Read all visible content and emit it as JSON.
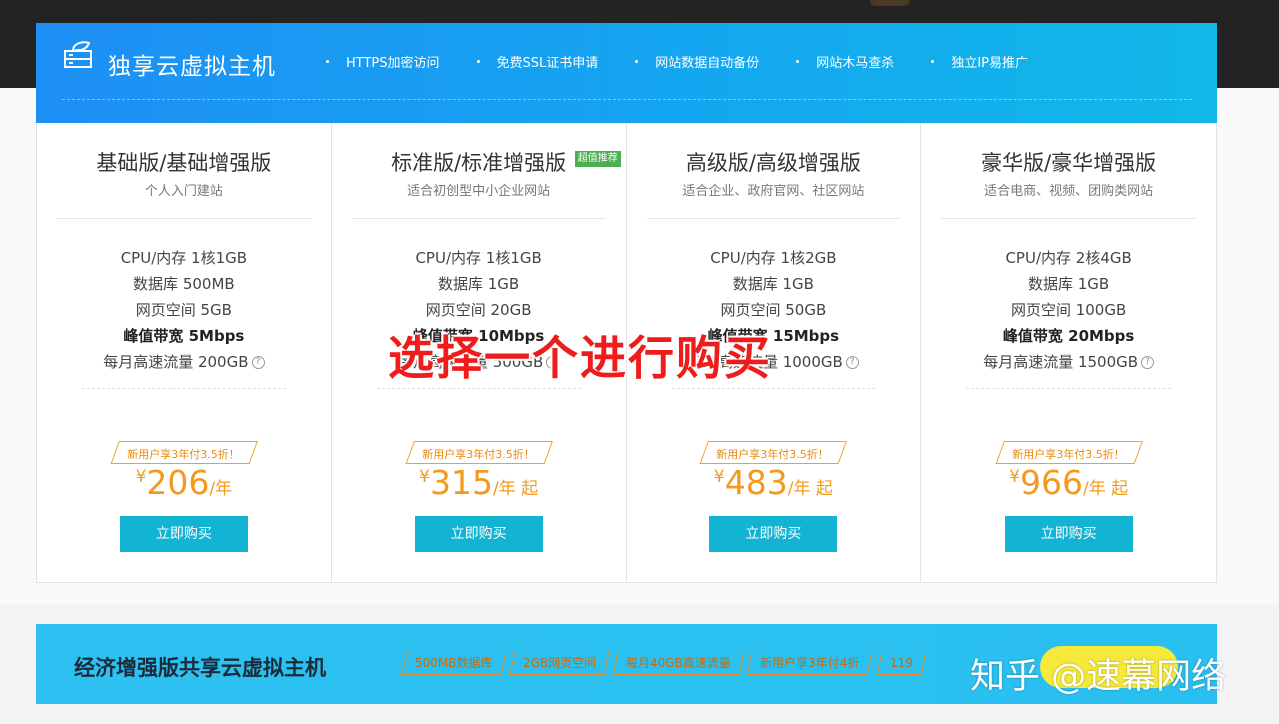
{
  "banner": {
    "title": "独享云虚拟主机",
    "features": [
      "HTTPS加密访问",
      "免费SSL证书申请",
      "网站数据自动备份",
      "网站木马查杀",
      "独立IP易推广"
    ]
  },
  "plans": [
    {
      "name": "基础版/基础增强版",
      "badge": "",
      "subtitle": "个人入门建站",
      "specs": [
        "CPU/内存 1核1GB",
        "数据库 500MB",
        "网页空间 5GB",
        "峰值带宽 5Mbps",
        "每月高速流量 200GB"
      ],
      "promo": "新用户享3年付3.5折！",
      "currency": "¥",
      "price": "206",
      "unit": "/年",
      "buy": "立即购买"
    },
    {
      "name": "标准版/标准增强版",
      "badge": "超值推荐",
      "subtitle": "适合初创型中小企业网站",
      "specs": [
        "CPU/内存 1核1GB",
        "数据库 1GB",
        "网页空间 20GB",
        "峰值带宽 10Mbps",
        "每月高速流量 500GB"
      ],
      "promo": "新用户享3年付3.5折！",
      "currency": "¥",
      "price": "315",
      "unit": "/年 起",
      "buy": "立即购买"
    },
    {
      "name": "高级版/高级增强版",
      "badge": "",
      "subtitle": "适合企业、政府官网、社区网站",
      "specs": [
        "CPU/内存 1核2GB",
        "数据库 1GB",
        "网页空间 50GB",
        "峰值带宽 15Mbps",
        "每月高速流量 1000GB"
      ],
      "promo": "新用户享3年付3.5折！",
      "currency": "¥",
      "price": "483",
      "unit": "/年 起",
      "buy": "立即购买"
    },
    {
      "name": "豪华版/豪华增强版",
      "badge": "",
      "subtitle": "适合电商、视频、团购类网站",
      "specs": [
        "CPU/内存 2核4GB",
        "数据库 1GB",
        "网页空间 100GB",
        "峰值带宽 20Mbps",
        "每月高速流量 1500GB"
      ],
      "promo": "新用户享3年付3.5折！",
      "currency": "¥",
      "price": "966",
      "unit": "/年 起",
      "buy": "立即购买"
    }
  ],
  "overlay_text": "选择一个进行购买",
  "bottom_banner": {
    "title": "经济增强版共享云虚拟主机",
    "tags": [
      "500MB数据库",
      "2GB网页空间",
      "每月40GB高速流量",
      "新用户享3年付4折",
      "119"
    ]
  },
  "watermark": "知乎 @速幕网络",
  "colors": {
    "banner_start": "#1e8ff5",
    "banner_end": "#11b8e8",
    "price": "#f39a1e",
    "button": "#13b3d3",
    "badge": "#4caf50",
    "overlay": "#ee1c1c"
  }
}
